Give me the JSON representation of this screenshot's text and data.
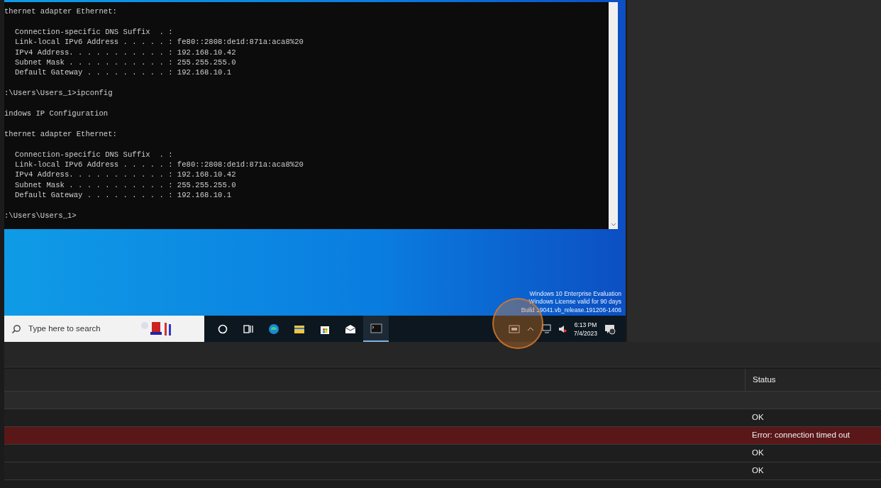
{
  "console": {
    "paragraphs": [
      {
        "lines": [
          "thernet adapter Ethernet:"
        ],
        "indented": false,
        "wide_gap": false
      },
      {
        "lines": [
          "Connection-specific DNS Suffix  . :",
          "Link-local IPv6 Address . . . . . : fe80::2808:de1d:871a:aca8%20",
          "IPv4 Address. . . . . . . . . . . : 192.168.10.42",
          "Subnet Mask . . . . . . . . . . . : 255.255.255.0",
          "Default Gateway . . . . . . . . . : 192.168.10.1"
        ],
        "indented": true,
        "wide_gap": false
      },
      {
        "lines": [
          ":\\Users\\Users_1>ipconfig"
        ],
        "indented": false,
        "wide_gap": false
      },
      {
        "lines": [
          "indows IP Configuration"
        ],
        "indented": false,
        "wide_gap": false
      },
      {
        "lines": [
          "thernet adapter Ethernet:"
        ],
        "indented": false,
        "wide_gap": true
      },
      {
        "lines": [
          "Connection-specific DNS Suffix  . :",
          "Link-local IPv6 Address . . . . . : fe80::2808:de1d:871a:aca8%20",
          "IPv4 Address. . . . . . . . . . . : 192.168.10.42",
          "Subnet Mask . . . . . . . . . . . : 255.255.255.0",
          "Default Gateway . . . . . . . . . : 192.168.10.1"
        ],
        "indented": true,
        "wide_gap": false
      },
      {
        "lines": [
          ":\\Users\\Users_1>"
        ],
        "indented": false,
        "wide_gap": false
      }
    ]
  },
  "desktop": {
    "license_lines": [
      "Windows 10 Enterprise Evaluation",
      "Windows License valid for 90 days",
      "Build 19041.vb_release.191206-1406"
    ]
  },
  "taskbar": {
    "search": {
      "placeholder": "Type here to search"
    },
    "apps": [
      {
        "kind": "cortana",
        "active": false
      },
      {
        "kind": "taskview",
        "active": false
      },
      {
        "kind": "browser",
        "active": false
      },
      {
        "kind": "folder",
        "active": false
      },
      {
        "kind": "store",
        "active": false
      },
      {
        "kind": "mail",
        "active": false
      },
      {
        "kind": "terminal",
        "active": true
      }
    ],
    "time": "6:13 PM",
    "date": "7/4/2023"
  },
  "table": {
    "columns": [
      "Status"
    ],
    "rows": [
      {
        "kind": "normal"
      },
      {
        "kind": "normal",
        "status": "OK"
      },
      {
        "kind": "error",
        "status": "Error: connection timed out"
      },
      {
        "kind": "normal",
        "status": "OK"
      },
      {
        "kind": "normal",
        "status": "OK"
      }
    ]
  }
}
